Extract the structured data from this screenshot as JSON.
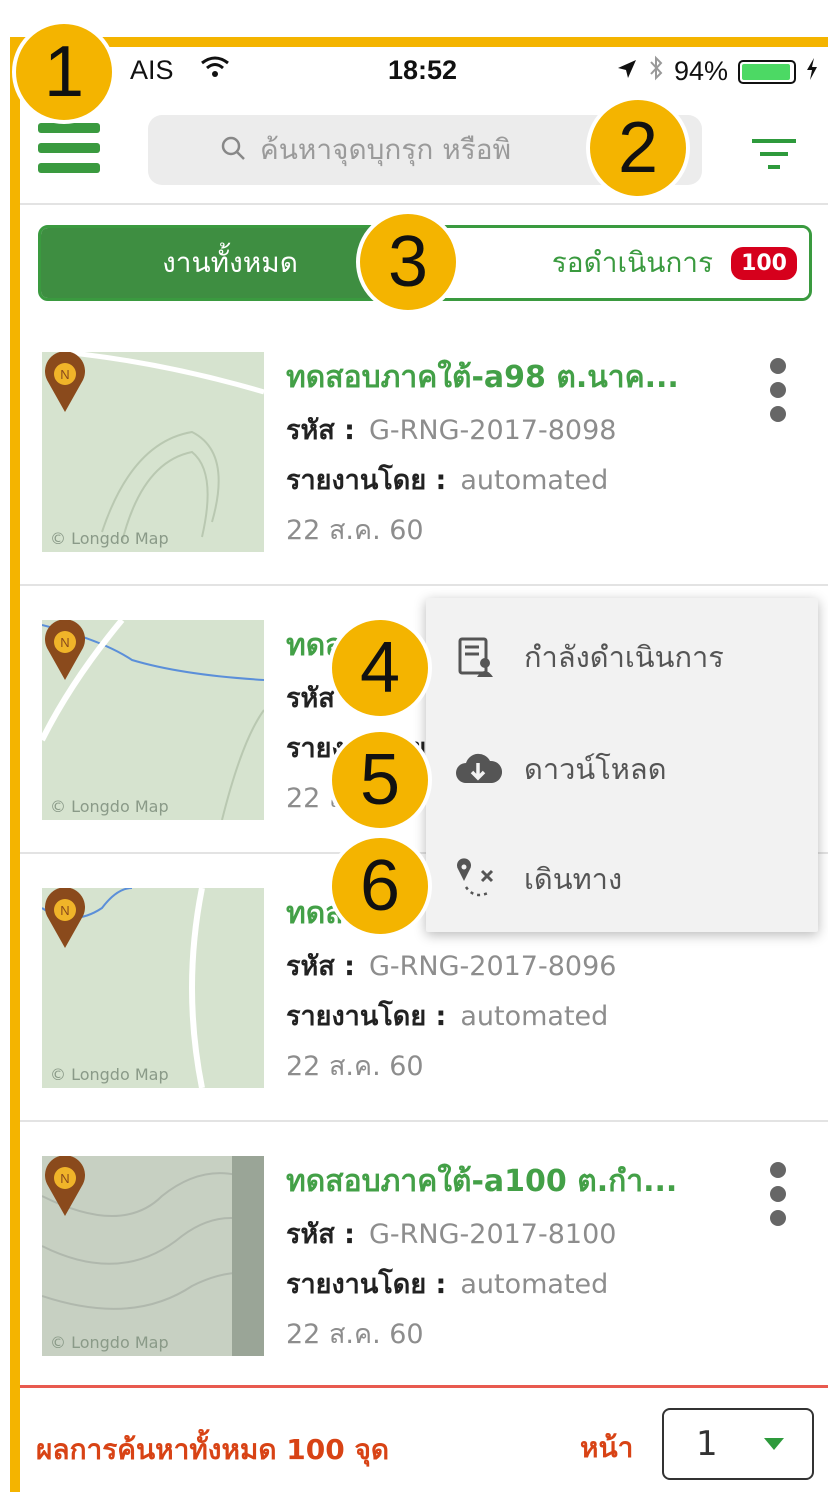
{
  "markers": [
    "1",
    "2",
    "3",
    "4",
    "5",
    "6"
  ],
  "status_bar": {
    "carrier": "AIS",
    "time": "18:52",
    "battery": "94%"
  },
  "header": {
    "search_placeholder": "ค้นหาจุดบุกรุก หรือพิ"
  },
  "tabs": {
    "all": "งานทั้งหมด",
    "pending": "รอดำเนินการ",
    "pending_count": "100"
  },
  "labels": {
    "code": "รหัส :",
    "reported_by": "รายงานโดย :",
    "map_credit": "© Longdo Map"
  },
  "items": [
    {
      "title": "ทดสอบภาคใต้-a98 ต.นาค...",
      "code": "G-RNG-2017-8098",
      "reporter": "automated",
      "date": "22 ส.ค. 60"
    },
    {
      "title": "ทดส",
      "code": "",
      "reporter": "",
      "date": "22 ส."
    },
    {
      "title": "ทดส",
      "code": "G-RNG-2017-8096",
      "reporter": "automated",
      "date": "22 ส.ค. 60"
    },
    {
      "title": "ทดสอบภาคใต้-a100 ต.กำ...",
      "code": "G-RNG-2017-8100",
      "reporter": "automated",
      "date": "22 ส.ค. 60"
    }
  ],
  "menu": [
    {
      "label": "กำลังดำเนินการ",
      "icon": "assign-user-icon"
    },
    {
      "label": "ดาวน์โหลด",
      "icon": "cloud-download-icon"
    },
    {
      "label": "เดินทาง",
      "icon": "route-icon"
    }
  ],
  "footer": {
    "result_text": "ผลการค้นหาทั้งหมด 100 จุด",
    "page_label": "หน้า",
    "page_value": "1"
  },
  "colors": {
    "primary_green": "#3e8e41",
    "badge_red": "#d6001c",
    "annotation_yellow": "#f4b400",
    "footer_orange": "#d84315"
  }
}
